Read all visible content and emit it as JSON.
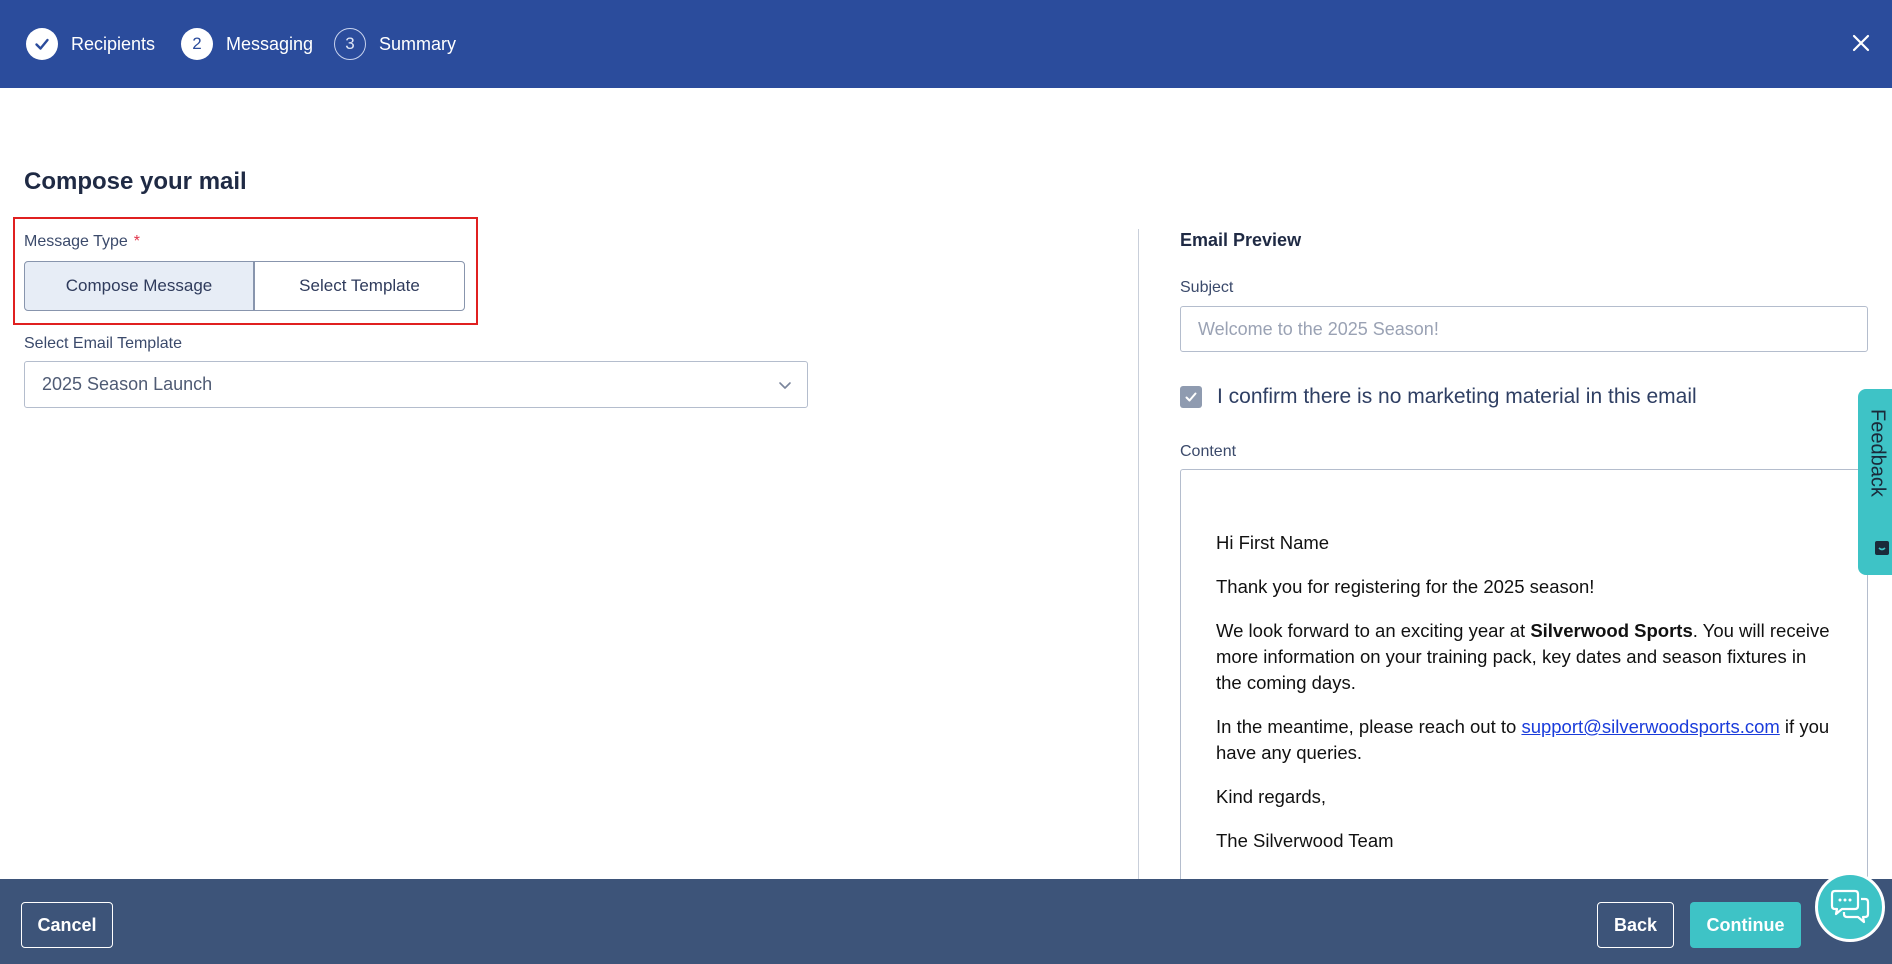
{
  "stepper": {
    "steps": [
      {
        "label": "Recipients",
        "number": "",
        "state": "done"
      },
      {
        "label": "Messaging",
        "number": "2",
        "state": "active"
      },
      {
        "label": "Summary",
        "number": "3",
        "state": "pending"
      }
    ],
    "close_icon": "close-icon"
  },
  "compose": {
    "title": "Compose your mail",
    "message_type_label": "Message Type",
    "required_marker": "*",
    "options": [
      "Compose Message",
      "Select Template"
    ],
    "selected_option": "Compose Message",
    "template_label": "Select Email Template",
    "template_value": "2025 Season Launch"
  },
  "preview": {
    "title": "Email Preview",
    "subject_label": "Subject",
    "subject_placeholder": "Welcome to the 2025 Season!",
    "confirm_text": "I confirm there is no marketing material in this email",
    "confirm_checked": true,
    "content_label": "Content",
    "content": {
      "greeting": "Hi First Name",
      "line1": "Thank you for registering for the 2025 season!",
      "line2_pre": "We look forward to an exciting year at ",
      "line2_bold": "Silverwood Sports",
      "line2_post": ". You will receive more information on your training pack, key dates and season fixtures in the coming days.",
      "line3_pre": "In the meantime, please reach out to ",
      "line3_link": "support@silverwoodsports.com",
      "line3_post": " if you have any queries.",
      "signoff": "Kind regards,",
      "signature": "The Silverwood Team"
    }
  },
  "feedback": {
    "label": "Feedback"
  },
  "footer": {
    "cancel_label": "Cancel",
    "back_label": "Back",
    "continue_label": "Continue"
  },
  "colors": {
    "header_bg": "#2b4c9c",
    "footer_bg": "#3d5479",
    "accent_teal": "#3ec3c6",
    "highlight_red": "#e02020"
  }
}
